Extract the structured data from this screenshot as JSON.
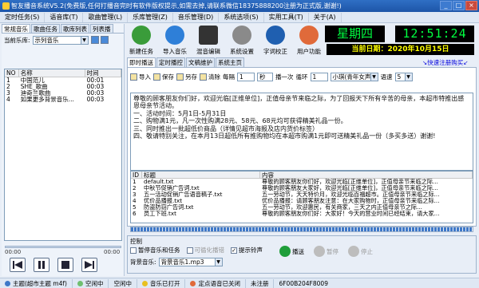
{
  "title": "智友播音系统V5.2(免费版,任何打播音完时有软件版权提示,如需去掉,请联系微信18375888200注册为正式版,谢谢!)",
  "menu": [
    "定时任务(S)",
    "语音库(T)",
    "歌曲管理(L)",
    "乐库管理(Z)",
    "音乐管理(D)",
    "系统选项(S)",
    "实用工具(T)",
    "关于(A)"
  ],
  "left": {
    "tabs": [
      "常规音乐",
      "歌曲任务",
      "歌库列表",
      "列表播"
    ],
    "current_label": "当前乐库:",
    "current_value": "示列音乐",
    "list_headers": [
      "NO",
      "名称",
      "时间"
    ],
    "list_items": [
      {
        "no": "1",
        "name": "中国范儿",
        "time": "00:01"
      },
      {
        "no": "2",
        "name": "SHE_歌曲",
        "time": "00:03"
      },
      {
        "no": "3",
        "name": "迪奇兰歌曲",
        "time": "00:03"
      },
      {
        "no": "4",
        "name": "如果更多背景音乐...",
        "time": "00:03"
      }
    ],
    "time_start": "00:00",
    "time_end": "00:00"
  },
  "toolbar": {
    "buttons": [
      "新建任务",
      "导入音乐",
      "混音编辑",
      "系统设置",
      "字词校正",
      "用户功能"
    ]
  },
  "clock": {
    "weekday": "星期四",
    "time": "12:51:24",
    "date": "当前日期：2020年10月15日"
  },
  "tabs2": [
    "即时播送",
    "定时播控",
    "文稿维护",
    "系统主页"
  ],
  "buy_link": "↘快速注册购买↙",
  "editor_toolbar": {
    "items": [
      "导入",
      "保存",
      "另存",
      "清除"
    ],
    "repeat_label": "每隔",
    "repeat_value": "1",
    "repeat_unit": "秒",
    "rounds_label": "播一次",
    "loop_label": "循环",
    "loop_value": "1",
    "voice_value": "小琪(青年女声)",
    "speed_label": "语速",
    "speed_value": "5"
  },
  "memo": "尊敬的顾客朋友你们好，欢迎光临[正维单位]，正值母亲节来临之际，为了回报天下所有辛苦的母亲，本超市特推出感恩母亲节活动。\n一、活动时间：5月1日-5月31日\n二、购物满1元，凡一次性购满28元、58元、68元均可获得精美礼品一份。\n三、同时推出一批超低价商品（详情见超市海报及店内货价标签）\n四、敬请特别关注，在本月13日超低所有推购物均在本超市购满1元即可送精美礼品一份（多买多送）谢谢!",
  "table": {
    "headers": [
      "ID",
      "标题",
      "内容"
    ],
    "rows": [
      {
        "id": "1",
        "title": "default.txt",
        "content": "尊敬的顾客朋友你们好，欢迎光临[正维单位]，正值母亲节来临之际..."
      },
      {
        "id": "2",
        "title": "中秋节促销广告词.txt",
        "content": "尊敬的顾客朋友大家好，欢迎光临[正维单位]，正值母亲节来临之际..."
      },
      {
        "id": "3",
        "title": "五一活动促销广告语音稿子.txt",
        "content": "五一劳动节，天天特价月，欢迎光临百福超市。正值母亲节来临之际..."
      },
      {
        "id": "4",
        "title": "优价品播报.txt",
        "content": "优价品播报：请顾客朋友注意：在大家购物时，正值母亲节来临之际..."
      },
      {
        "id": "5",
        "title": "防盗防窃广告词.txt",
        "content": "五一劳动节，欢迎惠民，有关商家，三天之内正值母亲节之际..."
      },
      {
        "id": "6",
        "title": "员工下班.txt",
        "content": "尊敬的顾客朋友你们好：大家好！今天的营业时间已经结束，请大家..."
      }
    ]
  },
  "control": {
    "label": "控制",
    "pause_music": "暂停音乐和任务",
    "loop_play": "可循化播错",
    "prompt_sound": "提示铃声",
    "bg_label": "背景音乐:",
    "bg_value": "背景音乐1.mp3",
    "broadcast": "播送",
    "pause": "暂停",
    "stop": "停止"
  },
  "status": [
    "主题(超市主题 m4f)",
    "空闲中",
    "空闲中",
    "音乐已打开",
    "定点语音已关闭",
    "未注册"
  ],
  "reg_code": "6F00B204F8009"
}
